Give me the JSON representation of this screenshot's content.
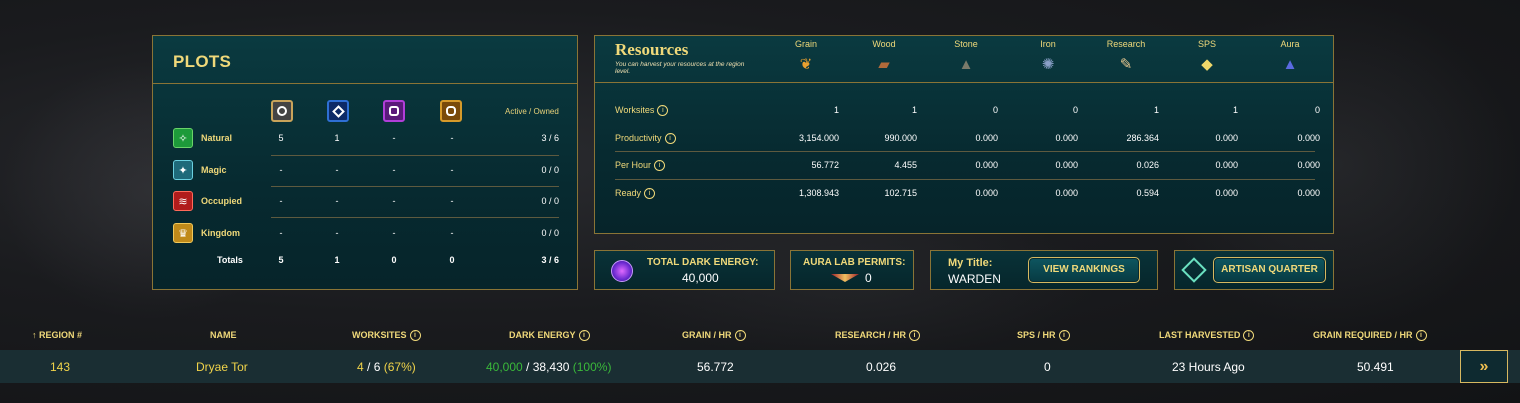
{
  "plots": {
    "title": "PLOTS",
    "active_owned_label": "Active / Owned",
    "rows": [
      {
        "name": "Natural",
        "c1": "5",
        "c2": "1",
        "c3": "-",
        "c4": "-",
        "ao": "3 / 6"
      },
      {
        "name": "Magic",
        "c1": "-",
        "c2": "-",
        "c3": "-",
        "c4": "-",
        "ao": "0 / 0"
      },
      {
        "name": "Occupied",
        "c1": "-",
        "c2": "-",
        "c3": "-",
        "c4": "-",
        "ao": "0 / 0"
      },
      {
        "name": "Kingdom",
        "c1": "-",
        "c2": "-",
        "c3": "-",
        "c4": "-",
        "ao": "0 / 0"
      }
    ],
    "totals": {
      "label": "Totals",
      "c1": "5",
      "c2": "1",
      "c3": "0",
      "c4": "0",
      "ao": "3 / 6"
    }
  },
  "resources": {
    "title": "Resources",
    "subtitle": "You can harvest your resources at the region level.",
    "columns": [
      "Grain",
      "Wood",
      "Stone",
      "Iron",
      "Research",
      "SPS",
      "Aura"
    ],
    "rows": [
      {
        "label": "Worksites",
        "values": [
          "1",
          "1",
          "0",
          "0",
          "1",
          "1",
          "0"
        ]
      },
      {
        "label": "Productivity",
        "values": [
          "3,154.000",
          "990.000",
          "0.000",
          "0.000",
          "286.364",
          "0.000",
          "0.000"
        ]
      },
      {
        "label": "Per Hour",
        "values": [
          "56.772",
          "4.455",
          "0.000",
          "0.000",
          "0.026",
          "0.000",
          "0.000"
        ]
      },
      {
        "label": "Ready",
        "values": [
          "1,308.943",
          "102.715",
          "0.000",
          "0.000",
          "0.594",
          "0.000",
          "0.000"
        ]
      }
    ]
  },
  "dark_energy": {
    "label": "TOTAL DARK ENERGY:",
    "value": "40,000"
  },
  "aura_lab": {
    "label": "AURA LAB PERMITS:",
    "value": "0"
  },
  "my_title": {
    "label": "My Title:",
    "value": "WARDEN",
    "button": "VIEW RANKINGS"
  },
  "artisan": {
    "button": "ARTISAN QUARTER"
  },
  "table": {
    "headers": {
      "region": "REGION #",
      "name": "NAME",
      "worksites": "WORKSITES",
      "dark_energy": "DARK ENERGY",
      "grain_hr": "GRAIN / HR",
      "research_hr": "RESEARCH / HR",
      "sps_hr": "SPS / HR",
      "last_harvested": "LAST HARVESTED",
      "grain_required": "GRAIN REQUIRED / HR"
    },
    "sort_icon": "↑",
    "row": {
      "region": "143",
      "name": "Dryae Tor",
      "worksites_active": "4",
      "worksites_sep": " / ",
      "worksites_total": "6",
      "worksites_pct": "(67%)",
      "dark_current": "40,000",
      "dark_sep": " / ",
      "dark_total": "38,430",
      "dark_pct": "(100%)",
      "grain_hr": "56.772",
      "research_hr": "0.026",
      "sps_hr": "0",
      "last_harvested": "23 Hours Ago",
      "grain_required": "50.491"
    },
    "go_icon": "»"
  },
  "colors": {
    "accent": "#f0d97a",
    "border": "#8a7436",
    "panel": "#072a30"
  }
}
